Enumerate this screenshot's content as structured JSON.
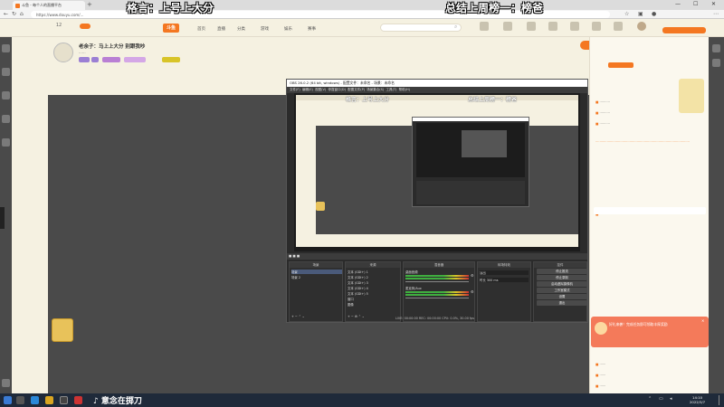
{
  "browser": {
    "tab_title": "斗鱼 - 每个人的直播平台",
    "new_tab": "+",
    "address": "https://www.douyu.com/...",
    "controls": {
      "minimize": "—",
      "maximize": "☐",
      "close": "✕"
    }
  },
  "overlay": {
    "left_text": "格言：上号上大分",
    "right_text": "总结上周榜一：榜爸"
  },
  "site": {
    "logo": "斗鱼",
    "nav": [
      "首页",
      "直播",
      "分类",
      "游戏",
      "娱乐",
      "赛事"
    ]
  },
  "stream": {
    "title": "老余子：马上上大分 别跟我吵",
    "follow_label": "+ 关注"
  },
  "obs": {
    "window_title": "OBS 26.0.2 (64 bit, windows) - 配置文件：未命名 - 场景：未命名",
    "menu": [
      "文件(F)",
      "编辑(E)",
      "视图(V)",
      "停靠窗口(D)",
      "配置文件(P)",
      "场景集合(S)",
      "工具(T)",
      "帮助(H)"
    ],
    "nested_overlay_left": "格言：上号上大分",
    "nested_overlay_right": "总结上周榜一：榜爸",
    "docks": {
      "scenes": {
        "title": "场景",
        "items": [
          "场景",
          "场景 2"
        ]
      },
      "sources": {
        "title": "来源",
        "items": [
          "文本 (GDI+) 1",
          "文本 (GDI+) 2",
          "文本 (GDI+) 3",
          "文本 (GDI+) 4",
          "文本 (GDI+) 5",
          "窗口",
          "图像"
        ]
      },
      "mixer": {
        "title": "混音器",
        "items": [
          "桌面音频",
          "麦克风/Aux"
        ]
      },
      "transitions": {
        "title": "转场特效",
        "items": [
          "淡出",
          "时长 300 ms"
        ]
      },
      "controls": {
        "title": "控件",
        "buttons": [
          "停止推流",
          "停止录制",
          "启动虚拟摄像机",
          "工作室模式",
          "设置",
          "退出"
        ]
      }
    },
    "status": "LIVE: 00:00:00  REC: 00:00:00  CPU: 0.0%, 30.00 fps"
  },
  "taskbar": {
    "tiktok_text": "意念在掷刀",
    "time": "14:10",
    "date": "2022/3/7"
  },
  "promo": {
    "text": "好礼来袭！完成任务即可领取丰厚奖励"
  }
}
